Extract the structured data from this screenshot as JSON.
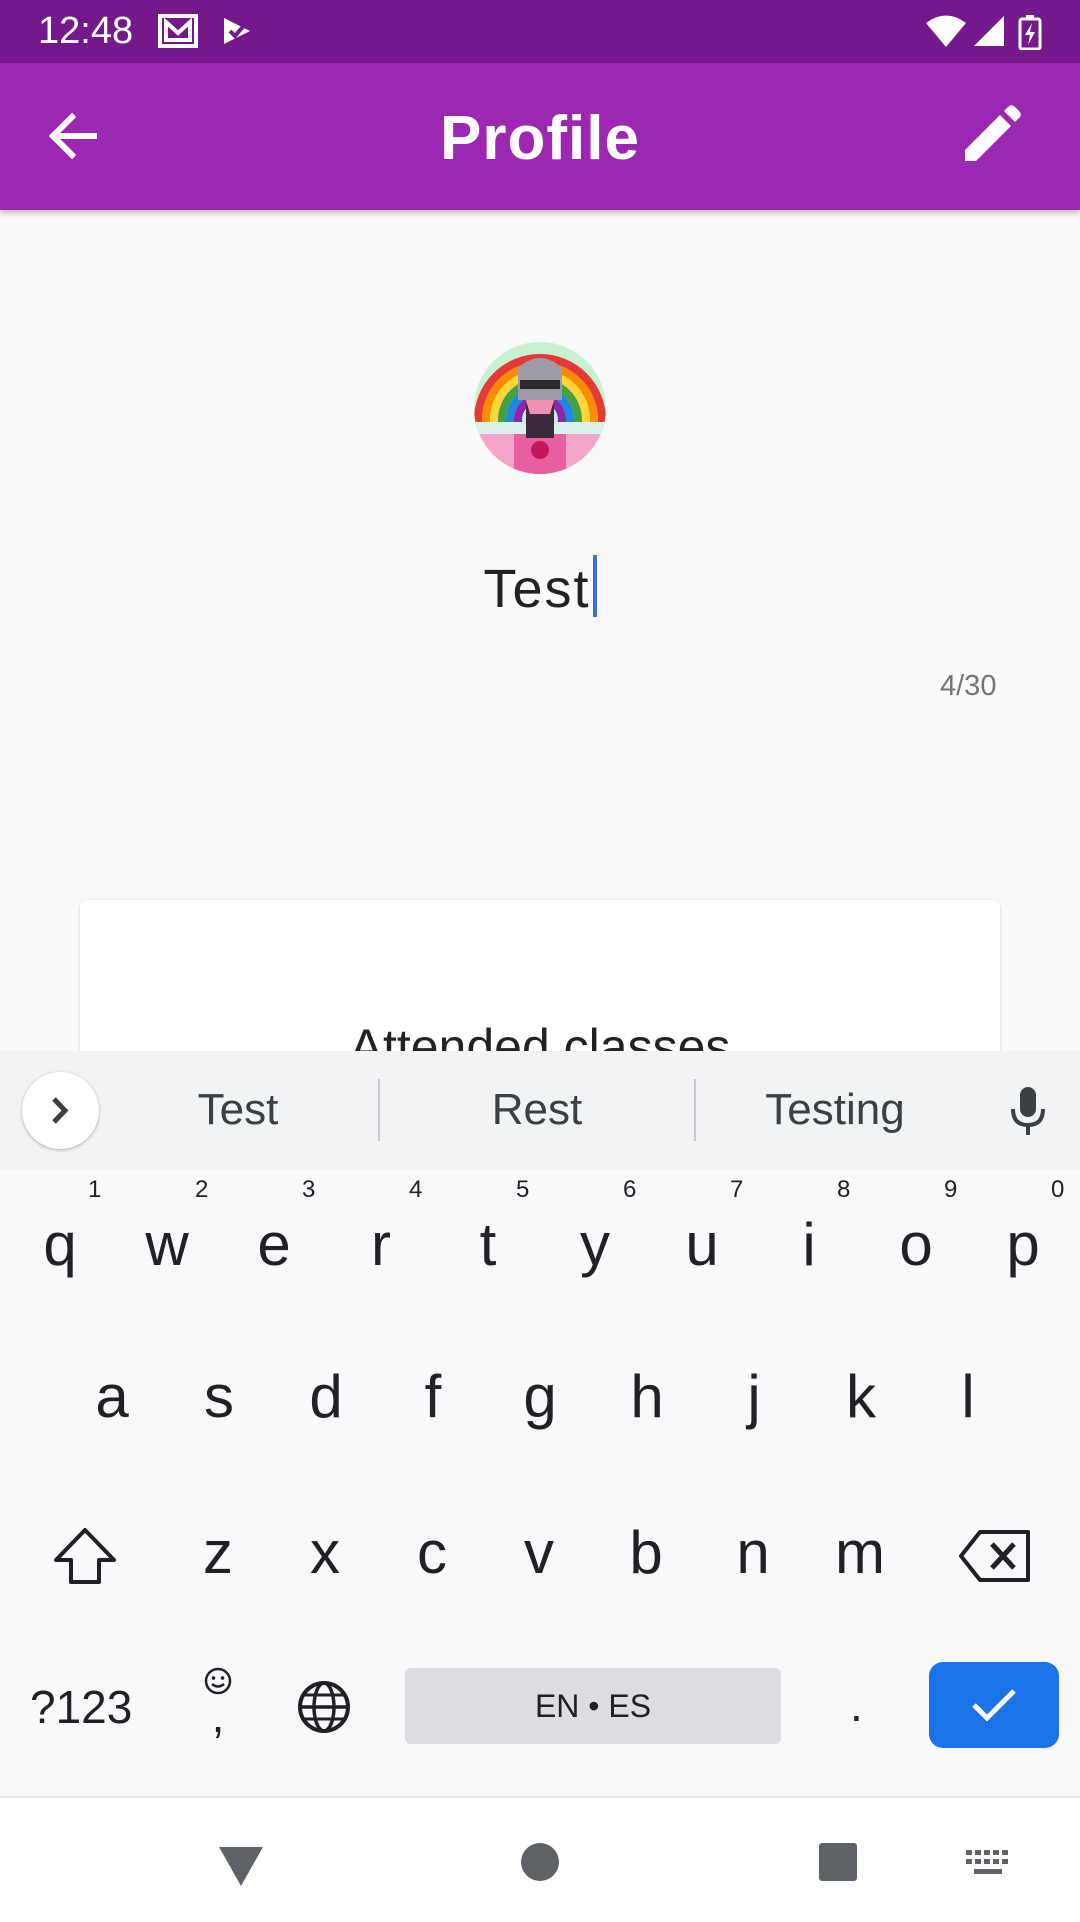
{
  "status_bar": {
    "time": "12:48",
    "icons": [
      "gmail-icon",
      "tasks-icon",
      "wifi-icon",
      "signal-icon",
      "battery-charging-icon"
    ]
  },
  "app_bar": {
    "title": "Profile",
    "back_icon": "arrow-back-icon",
    "edit_icon": "pencil-icon",
    "color": "#9c27b0",
    "status_color": "#74198b"
  },
  "profile": {
    "name_value": "Test",
    "char_counter": "4/30",
    "avatar": "robocop-rainbow-avatar"
  },
  "card": {
    "title": "Attended classes"
  },
  "keyboard": {
    "suggestions": [
      "Test",
      "Rest",
      "Testing"
    ],
    "row1": [
      {
        "key": "q",
        "hint": "1"
      },
      {
        "key": "w",
        "hint": "2"
      },
      {
        "key": "e",
        "hint": "3"
      },
      {
        "key": "r",
        "hint": "4"
      },
      {
        "key": "t",
        "hint": "5"
      },
      {
        "key": "y",
        "hint": "6"
      },
      {
        "key": "u",
        "hint": "7"
      },
      {
        "key": "i",
        "hint": "8"
      },
      {
        "key": "o",
        "hint": "9"
      },
      {
        "key": "p",
        "hint": "0"
      }
    ],
    "row2": [
      "a",
      "s",
      "d",
      "f",
      "g",
      "h",
      "j",
      "k",
      "l"
    ],
    "row3": [
      "z",
      "x",
      "c",
      "v",
      "b",
      "n",
      "m"
    ],
    "symbols_label": "?123",
    "comma_label": ",",
    "space_label": "EN • ES",
    "period_label": ".",
    "accent_color": "#1a73e8"
  },
  "nav_bar": {
    "icons": [
      "back-triangle-icon",
      "home-circle-icon",
      "recents-square-icon",
      "keyboard-switch-icon"
    ]
  }
}
